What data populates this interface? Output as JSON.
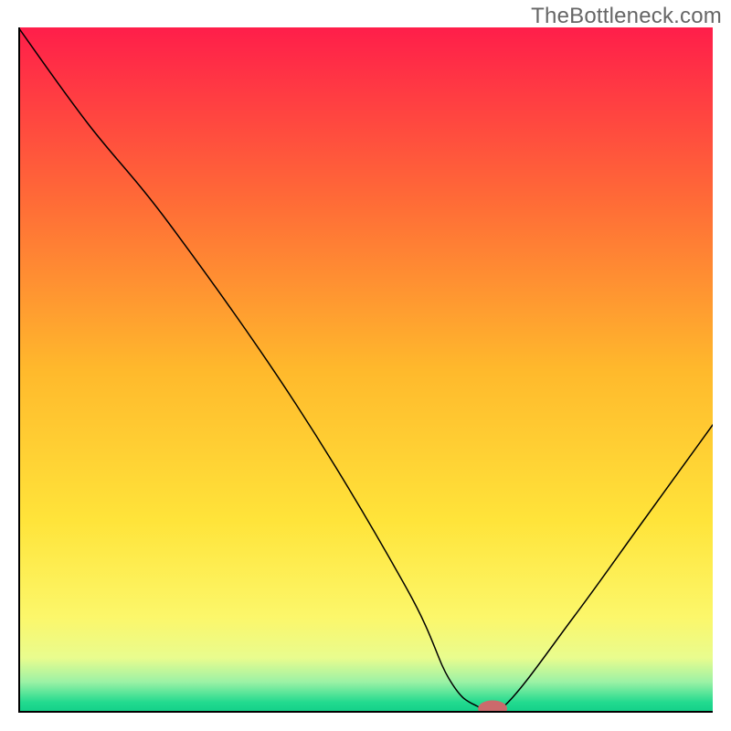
{
  "watermark": "TheBottleneck.com",
  "chart_data": {
    "type": "line",
    "title": "",
    "xlabel": "",
    "ylabel": "",
    "xlim": [
      0,
      100
    ],
    "ylim": [
      0,
      100
    ],
    "axes": {
      "left": true,
      "bottom": true,
      "grid": false
    },
    "gradient_stops": [
      {
        "offset": 0.0,
        "color": "#ff1e4a"
      },
      {
        "offset": 0.25,
        "color": "#ff6a37"
      },
      {
        "offset": 0.5,
        "color": "#ffb92c"
      },
      {
        "offset": 0.72,
        "color": "#ffe43a"
      },
      {
        "offset": 0.86,
        "color": "#fcf76a"
      },
      {
        "offset": 0.92,
        "color": "#e9fc8e"
      },
      {
        "offset": 0.955,
        "color": "#9cf2a5"
      },
      {
        "offset": 0.985,
        "color": "#22da8f"
      },
      {
        "offset": 1.0,
        "color": "#12cf88"
      }
    ],
    "series": [
      {
        "name": "bottleneck_curve",
        "x": [
          0,
          10,
          22,
          40,
          56,
          62,
          66,
          70,
          80,
          90,
          100
        ],
        "y": [
          100,
          86,
          71,
          45,
          18,
          5,
          1,
          1,
          14,
          28,
          42
        ]
      }
    ],
    "marker": {
      "name": "current_point",
      "x": 68.3,
      "y": 0.6,
      "color": "#cb6a6c",
      "rx": 2.1,
      "ry": 1.2
    }
  }
}
